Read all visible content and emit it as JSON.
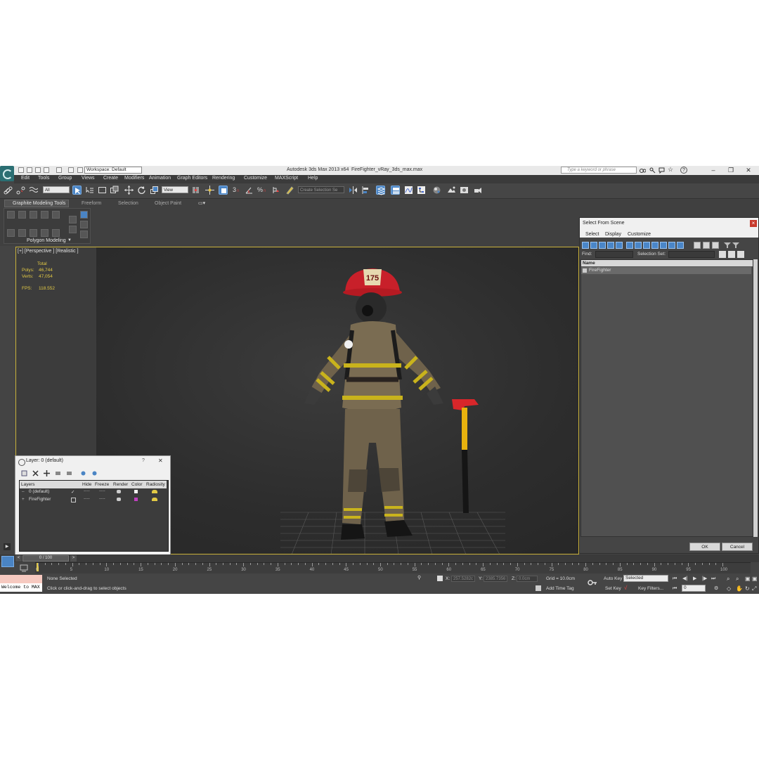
{
  "titlebar": {
    "workspace": "Workspace: Default",
    "app_title": "Autodesk 3ds Max  2013 x64",
    "file_name": "FireFighter_vRay_3ds_max.max",
    "search_placeholder": "Type a keyword or phrase",
    "help_label": "?"
  },
  "menu": [
    "Edit",
    "Tools",
    "Group",
    "Views",
    "Create",
    "Modifiers",
    "Animation",
    "Graph Editors",
    "Rendering",
    "Customize",
    "MAXScript",
    "Help"
  ],
  "toolbar": {
    "selection_filter": "All",
    "reference_coord": "View",
    "selection_set_placeholder": "Create Selection Se",
    "snap_labels": [
      "3",
      "%"
    ]
  },
  "ribbon": {
    "tabs": [
      "Graphite Modeling Tools",
      "Freeform",
      "Selection",
      "Object Paint"
    ],
    "panel_label": "Polygon Modeling"
  },
  "viewport": {
    "label": "[+] [Perspective ] [Realistic ]",
    "stats": {
      "total_label": "Total",
      "polys_label": "Polys:",
      "polys_value": "46,744",
      "verts_label": "Verts:",
      "verts_value": "47,054",
      "fps_label": "FPS:",
      "fps_value": "118.552"
    },
    "helmet_number": "175"
  },
  "select_from_scene": {
    "title": "Select From Scene",
    "menu": [
      "Select",
      "Display",
      "Customize"
    ],
    "find_label": "Find:",
    "selection_set_label": "Selection Set:",
    "column_name": "Name",
    "items": [
      "FireFighter"
    ],
    "ok_label": "OK",
    "cancel_label": "Cancel"
  },
  "layer_dialog": {
    "title": "Layer: 0 (default)",
    "help": "?",
    "close": "✕",
    "columns": [
      "Layers",
      "Hide",
      "Freeze",
      "Render",
      "Color",
      "Radiosity"
    ],
    "rows": [
      {
        "name": "0 (default)",
        "check": "✓",
        "hide": "----",
        "freeze": "----"
      },
      {
        "name": "FireFighter",
        "check": "",
        "hide": "----",
        "freeze": "----"
      }
    ]
  },
  "timeline": {
    "frame_display": "0 / 100",
    "prev": "<",
    "next": ">",
    "ticks": [
      "0",
      "5",
      "10",
      "15",
      "20",
      "25",
      "30",
      "35",
      "40",
      "45",
      "50",
      "55",
      "60",
      "65",
      "70",
      "75",
      "80",
      "85",
      "90",
      "95",
      "100"
    ]
  },
  "status": {
    "maxscript": "Welcome to MAX",
    "selection_info": "None Selected",
    "prompt": "Click or click-and-drag to select objects",
    "x_label": "X:",
    "x_value": "257.5282c",
    "y_label": "Y:",
    "y_value": "2385.7356",
    "z_label": "Z:",
    "z_value": "0.0cm",
    "grid": "Grid = 10.0cm",
    "add_time_tag": "Add Time Tag",
    "auto_key": "Auto Key",
    "set_key": "Set Key",
    "key_mode": "Selected",
    "key_filters": "Key Filters...",
    "current_frame": "0"
  },
  "colors": {
    "app_bg": "#444444",
    "viewport_border": "#c9b13a",
    "stats_text": "#e2c945",
    "highlight_blue": "#4a84c4",
    "layer_color_swatch": "#c040c0"
  }
}
